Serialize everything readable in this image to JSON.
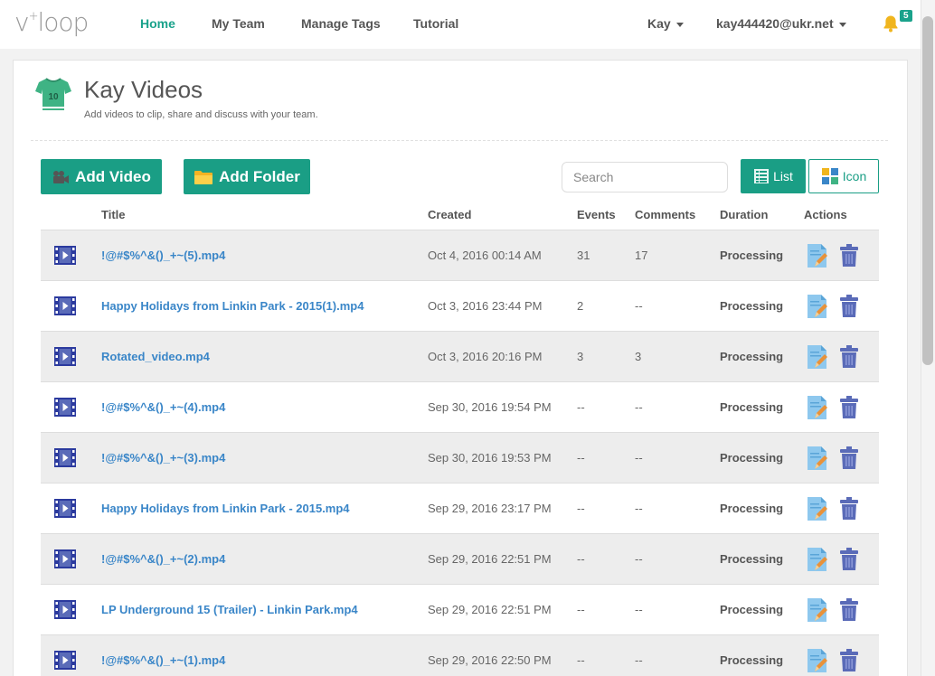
{
  "nav": {
    "logo_main": "v",
    "logo_plus": "+",
    "logo_rest": "loop",
    "links": [
      "Home",
      "My Team",
      "Manage Tags",
      "Tutorial"
    ],
    "user_name": "Kay",
    "user_email": "kay444420@ukr.net",
    "notification_count": "5"
  },
  "page": {
    "jersey_number": "10",
    "title": "Kay Videos",
    "subtitle": "Add videos to clip, share and discuss with your team."
  },
  "toolbar": {
    "add_video": "Add Video",
    "add_folder": "Add Folder",
    "search_placeholder": "Search",
    "list_label": "List",
    "icon_label": "Icon"
  },
  "table": {
    "headers": {
      "title": "Title",
      "created": "Created",
      "events": "Events",
      "comments": "Comments",
      "duration": "Duration",
      "actions": "Actions"
    },
    "rows": [
      {
        "title": "!@#$%^&()_+~(5).mp4",
        "created": "Oct 4, 2016 00:14 AM",
        "events": "31",
        "comments": "17",
        "duration": "Processing"
      },
      {
        "title": "Happy Holidays from Linkin Park - 2015(1).mp4",
        "created": "Oct 3, 2016 23:44 PM",
        "events": "2",
        "comments": "--",
        "duration": "Processing"
      },
      {
        "title": "Rotated_video.mp4",
        "created": "Oct 3, 2016 20:16 PM",
        "events": "3",
        "comments": "3",
        "duration": "Processing"
      },
      {
        "title": "!@#$%^&()_+~(4).mp4",
        "created": "Sep 30, 2016 19:54 PM",
        "events": "--",
        "comments": "--",
        "duration": "Processing"
      },
      {
        "title": "!@#$%^&()_+~(3).mp4",
        "created": "Sep 30, 2016 19:53 PM",
        "events": "--",
        "comments": "--",
        "duration": "Processing"
      },
      {
        "title": "Happy Holidays from Linkin Park - 2015.mp4",
        "created": "Sep 29, 2016 23:17 PM",
        "events": "--",
        "comments": "--",
        "duration": "Processing"
      },
      {
        "title": "!@#$%^&()_+~(2).mp4",
        "created": "Sep 29, 2016 22:51 PM",
        "events": "--",
        "comments": "--",
        "duration": "Processing"
      },
      {
        "title": "LP Underground 15 (Trailer) - Linkin Park.mp4",
        "created": "Sep 29, 2016 22:51 PM",
        "events": "--",
        "comments": "--",
        "duration": "Processing"
      },
      {
        "title": "!@#$%^&()_+~(1).mp4",
        "created": "Sep 29, 2016 22:50 PM",
        "events": "--",
        "comments": "--",
        "duration": "Processing"
      }
    ]
  },
  "icons": {
    "video_row": "film-icon",
    "edit": "edit-icon",
    "delete": "trash-icon",
    "notifications": "bell-icon",
    "add_video": "camera-icon",
    "add_folder": "folder-icon",
    "list_view": "list-icon",
    "icon_view": "grid-icon"
  },
  "colors": {
    "accent": "#1a9e85",
    "link": "#3a86c8",
    "row_alt": "#ededed",
    "bell": "#f0b51e",
    "trash": "#5a6bb8"
  }
}
